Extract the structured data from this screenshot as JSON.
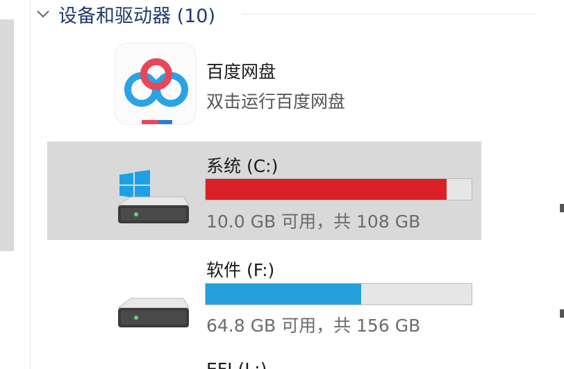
{
  "group": {
    "title": "设备和驱动器 (10)"
  },
  "app": {
    "name": "百度网盘",
    "subtitle": "双击运行百度网盘",
    "icon": "baidu-netdisk-icon"
  },
  "drives": [
    {
      "label": "系统 (C:)",
      "space_text": "10.0 GB 可用，共 108 GB",
      "used_fraction": 0.907,
      "bar_color": "#da2128",
      "selected": true,
      "icon": "windows-drive-icon"
    },
    {
      "label": "软件 (F:)",
      "space_text": "64.8 GB 可用，共 156 GB",
      "used_fraction": 0.585,
      "bar_color": "#26a0da",
      "selected": false,
      "icon": "hard-drive-icon"
    }
  ],
  "partial_next": {
    "label": "EFI (L:)"
  },
  "colors": {
    "header_text": "#1f3a6e",
    "selection_bg": "#d9d9d9",
    "bar_track": "#e6e6e6"
  }
}
